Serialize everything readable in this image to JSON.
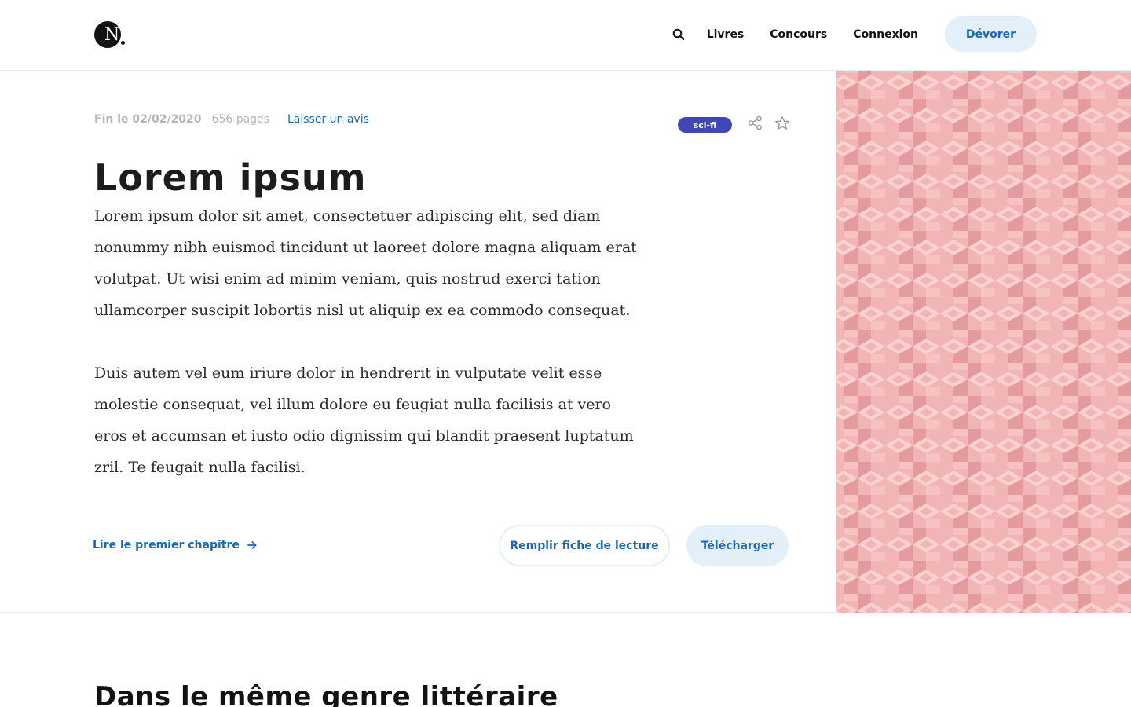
{
  "header": {
    "logo_letter": "N",
    "nav": {
      "search_icon": "search-icon",
      "links": [
        "Livres",
        "Concours",
        "Connexion"
      ],
      "cta_label": "Dévorer"
    }
  },
  "book": {
    "end_date": "Fin le 02/02/2020",
    "pages": "656 pages",
    "review_link": "Laisser un avis",
    "tag": "sci-fi",
    "share_icon": "share-icon",
    "favorite_icon": "star-icon",
    "title": "Lorem ipsum",
    "paragraphs": [
      "Lorem ipsum dolor sit amet, consectetuer adipiscing elit, sed diam nonummy nibh euismod tincidunt ut laoreet dolore magna aliquam erat volutpat. Ut wisi enim ad minim veniam, quis nostrud exerci tation ullamcorper suscipit lobortis nisl ut aliquip ex ea commodo consequat.",
      "Duis autem vel eum iriure dolor in hendrerit in vulputate velit esse molestie consequat, vel illum dolore eu feugiat nulla facilisis at vero eros et accumsan et iusto odio dignissim qui blandit praesent luptatum zril. Te feugait nulla facilisi."
    ],
    "read_first_chapter": "Lire le premier chapitre",
    "fill_sheet_button": "Remplir fiche de lecture",
    "download_button": "Télécharger"
  },
  "colors": {
    "accent": "#1a68b4",
    "accent_light": "#e3eff9",
    "tag_bg": "#3f48b5",
    "pattern_bg": "#f1b5b5"
  },
  "related": {
    "heading": "Dans le même genre littéraire"
  }
}
